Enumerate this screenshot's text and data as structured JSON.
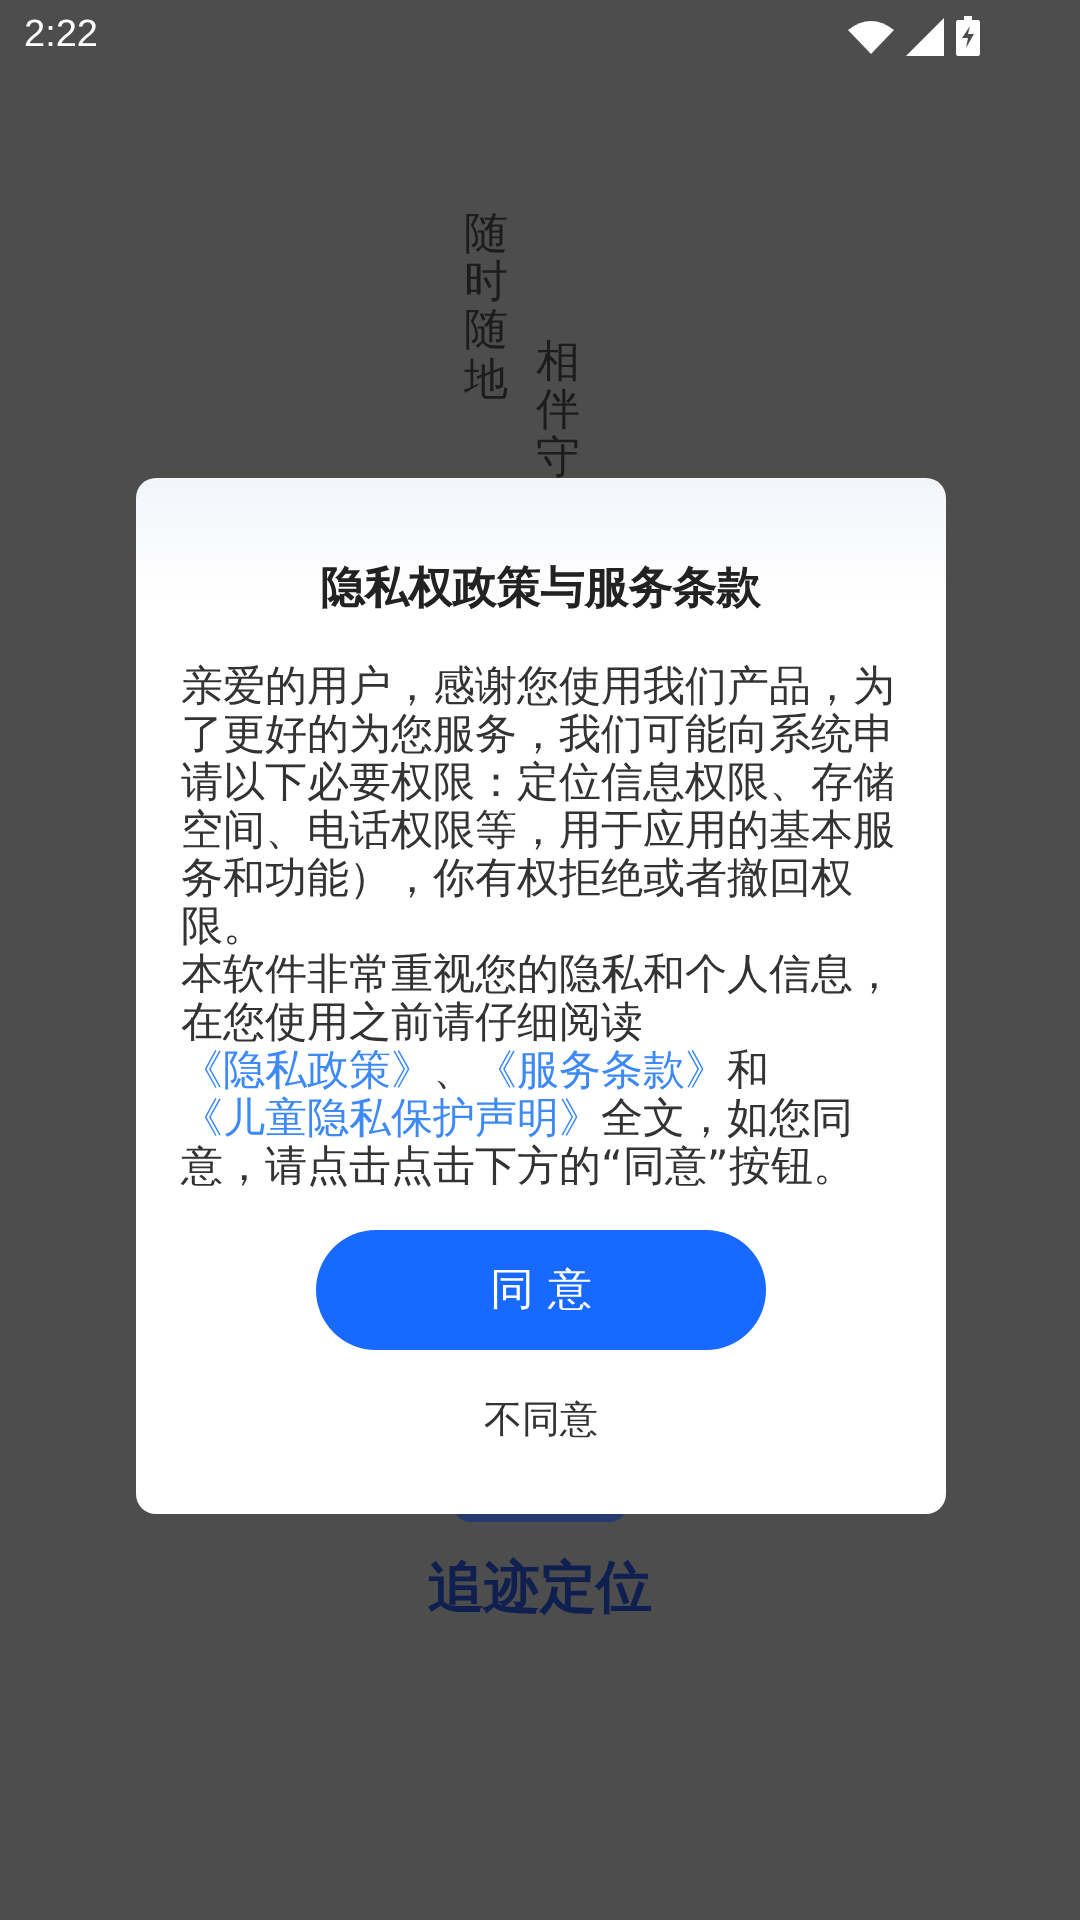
{
  "status_bar": {
    "time": "2:22"
  },
  "background": {
    "slogans": [
      "随时随地",
      "相伴守"
    ],
    "app_name": "追迹定位"
  },
  "dialog": {
    "title": "隐私权政策与服务条款",
    "paragraphs": [
      [
        {
          "kind": "text",
          "text": "亲爱的用户，感谢您使用我们产品，为了更好的为您服务，我们可能向系统申请以下必要权限：定位信息权限、存储空间、电话权限等，用于应用的基本服务和功能），你有权拒绝或者撤回权限。"
        }
      ],
      [
        {
          "kind": "text",
          "text": "本软件非常重视您的隐私和个人信息，在您使用之前请仔细阅读"
        },
        {
          "kind": "link",
          "text": "《隐私政策》"
        },
        {
          "kind": "text",
          "text": "、"
        },
        {
          "kind": "link",
          "text": "《服务条款》"
        },
        {
          "kind": "text",
          "text": "和"
        },
        {
          "kind": "link",
          "text": "《儿童隐私保护声明》"
        },
        {
          "kind": "text",
          "text": "全文，如您同意，请点击点击下方的“同意”按钮。"
        }
      ]
    ],
    "agree_button": "同 意",
    "decline_button": "不同意"
  }
}
